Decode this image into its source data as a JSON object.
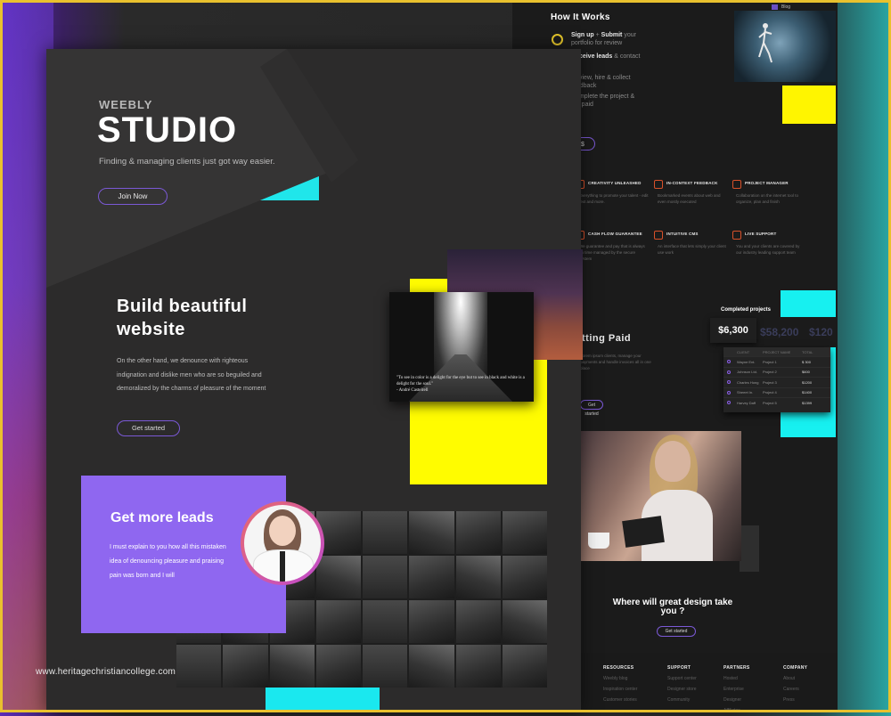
{
  "back_page": {
    "nav": {
      "item": "Blog"
    },
    "how_it_works": {
      "title": "How It Works",
      "steps": [
        {
          "strong": "Sign up",
          "sep": "+",
          "strong2": "Submit",
          "rest": "your portfolio for review"
        },
        {
          "strong": "Receive leads",
          "rest": "& contact"
        },
        {
          "strong": "",
          "rest": "Review, hire & collect feedback"
        },
        {
          "strong": "",
          "rest": "Complete the project & get paid"
        }
      ],
      "button_label": "$"
    },
    "features": [
      {
        "title": "CREATIVITY UNLEASHED",
        "desc": "Everything to promote your talent - edit text and more."
      },
      {
        "title": "IN-CONTEXT FEEDBACK",
        "desc": "Bookmarked events about web and even mostly executed"
      },
      {
        "title": "PROJECT MANAGER",
        "desc": "Collaboration on the internet tool to organize, plan and finish"
      },
      {
        "title": "CASH FLOW GUARANTEE",
        "desc": "We guarantee and pay that is always on time managed by the secure system"
      },
      {
        "title": "INTUITIVE CMS",
        "desc": "An interface that lets simply your client use work"
      },
      {
        "title": "LIVE SUPPORT",
        "desc": "You and your clients are covered by our industry leading support team"
      }
    ],
    "getting_paid": {
      "title": "tting Paid",
      "desc": "Lorem ipsum clients, manage your payments and handle invoices all in one place",
      "button_label": "Get started"
    },
    "completed": {
      "title": "Completed projects",
      "amount": "$6,300",
      "ghost_amounts": [
        "$58,200",
        "$120"
      ],
      "columns": [
        "CLIENT",
        "PROJECT NAME",
        "TOTAL"
      ],
      "rows": [
        [
          "Wayne Ent.",
          "Project 1",
          "$ 300"
        ],
        [
          "Johnson Ltd.",
          "Project 2",
          "$600"
        ],
        [
          "Charles Hong",
          "Project 3",
          "$1200"
        ],
        [
          "Sheeet In.",
          "Project 4",
          "$1400"
        ],
        [
          "Harvey Daff",
          "Project 5",
          "$1399"
        ]
      ]
    },
    "design_cta": {
      "title": "Where will great design take you ?",
      "button_label": "Get started"
    },
    "footer": [
      {
        "heading": "RESOURCES",
        "items": [
          "Weebly blog",
          "Inspiration center",
          "Customer stories"
        ]
      },
      {
        "heading": "SUPPORT",
        "items": [
          "Support center",
          "Designer store",
          "Community"
        ]
      },
      {
        "heading": "PARTNERS",
        "items": [
          "Hosted",
          "Enterprise",
          "Designer",
          "Affiliates"
        ]
      },
      {
        "heading": "COMPANY",
        "items": [
          "About",
          "Careers",
          "Press"
        ]
      }
    ]
  },
  "hero": {
    "brand": "WEEBLY",
    "title": "STUDIO",
    "tagline": "Finding & managing clients just got way easier.",
    "join_label": "Join Now"
  },
  "build": {
    "title_line1": "Build beautiful",
    "title_line2": "website",
    "desc": "On the other hand, we denounce with righteous indignation and dislike men who are so beguiled and demoralized by the charms of pleasure of the moment",
    "button_label": "Get started"
  },
  "street_card": {
    "quote": "\"To see in color is a delight for the eye but to see in black and white is a delight for the soul.\"",
    "author": "- André Castelrell"
  },
  "leads": {
    "title": "Get more leads",
    "desc": "I must explain to you how all this mistaken idea of denouncing pleasure and praising pain was born and I will"
  },
  "watermark": "www.heritagechristiancollege.com",
  "colors": {
    "accent_purple": "#8f67f0",
    "accent_yellow": "#fffc00",
    "accent_cyan": "#1ae8ef",
    "page_dark": "#2c2b2b"
  }
}
